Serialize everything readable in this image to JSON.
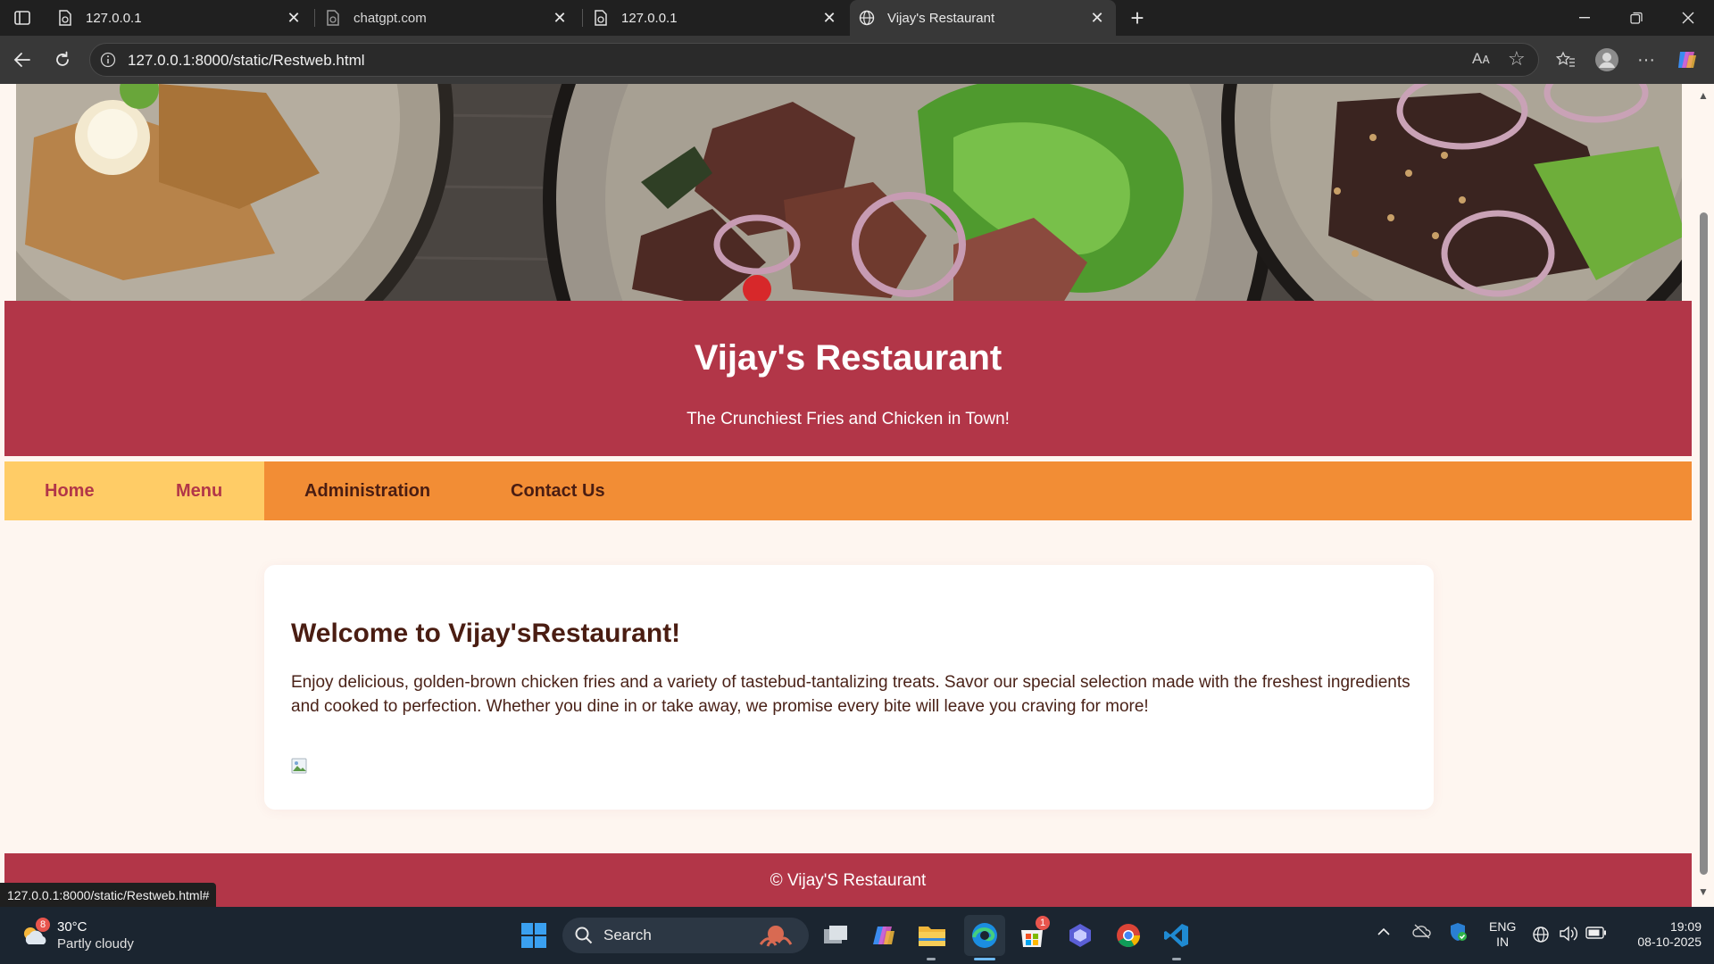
{
  "browser": {
    "tabs": [
      {
        "title": "127.0.0.1"
      },
      {
        "title": "chatgpt.com"
      },
      {
        "title": "127.0.0.1"
      },
      {
        "title": "Vijay's Restaurant"
      }
    ],
    "url": "127.0.0.1:8000/static/Restweb.html",
    "read_aloud": "Aᴀ",
    "status_url": "127.0.0.1:8000/static/Restweb.html#"
  },
  "site": {
    "title": "Vijay's Restaurant",
    "tagline": "The Crunchiest Fries and Chicken in Town!",
    "nav": [
      {
        "label": "Home"
      },
      {
        "label": "Menu"
      },
      {
        "label": "Administration"
      },
      {
        "label": "Contact Us"
      }
    ],
    "welcome_heading": "Welcome to Vijay'sRestaurant!",
    "welcome_text": "Enjoy delicious, golden-brown chicken fries and a variety of tastebud-tantalizing treats. Savor our special selection made with the freshest ingredients and cooked to perfection. Whether you dine in or take away, we promise every bite will leave you craving for more!",
    "footer": "© Vijay'S Restaurant",
    "colors": {
      "brand": "#b23648",
      "nav": "#f28d35",
      "nav_highlight": "#ffcc66",
      "background": "#fef6f0"
    }
  },
  "taskbar": {
    "weather_temp": "30°C",
    "weather_condition": "Partly cloudy",
    "weather_badge": "8",
    "search_label": "Search",
    "store_badge": "1",
    "lang_line1": "ENG",
    "lang_line2": "IN",
    "time": "19:09",
    "date": "08-10-2025"
  }
}
